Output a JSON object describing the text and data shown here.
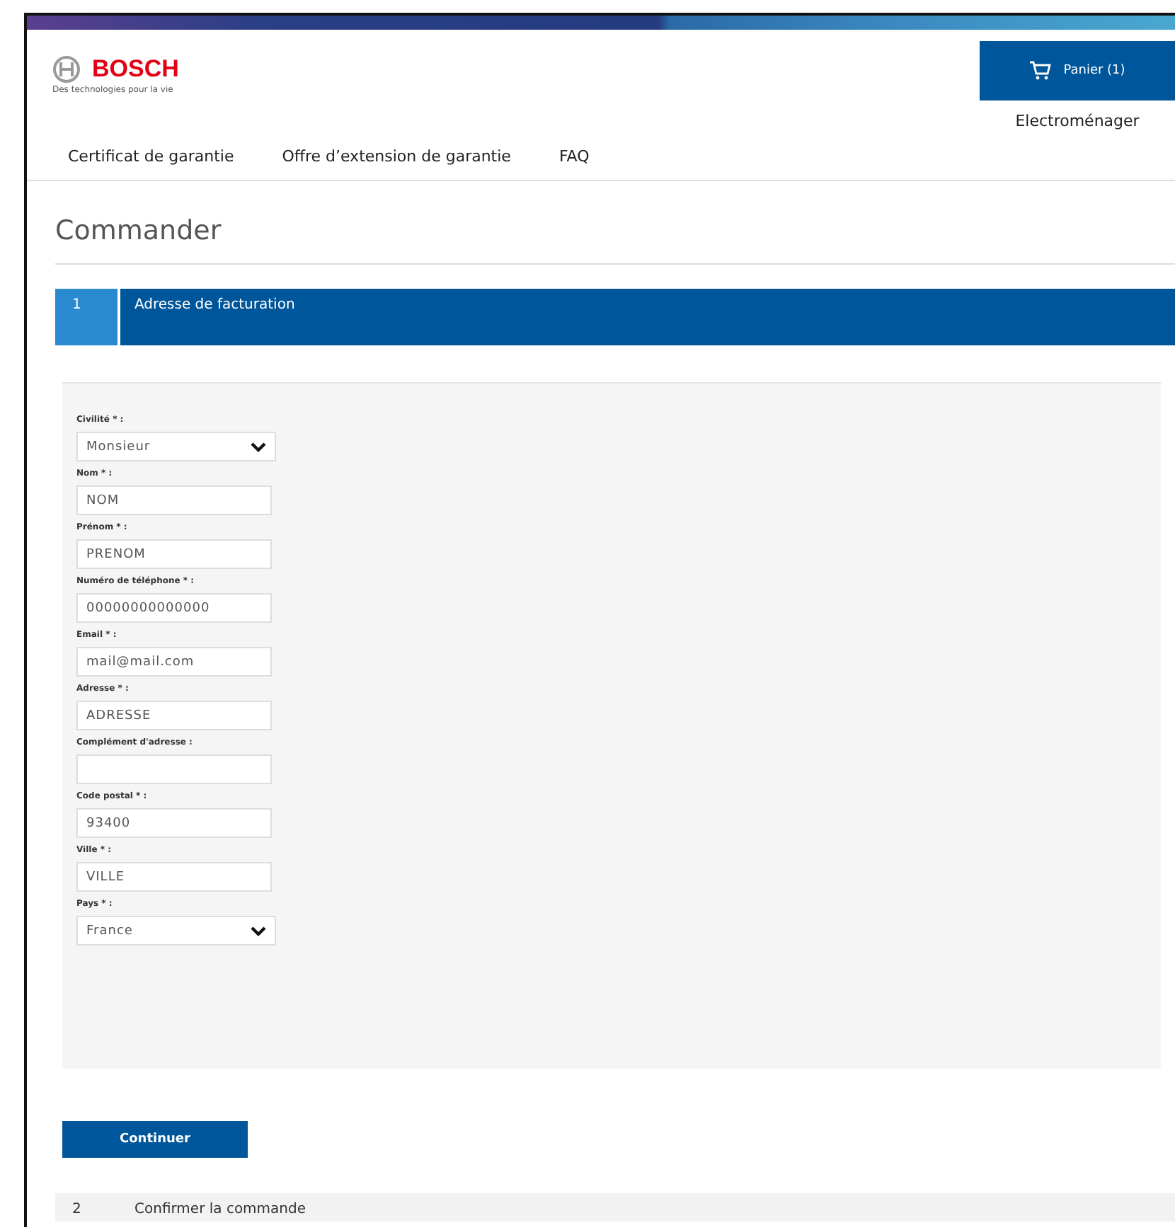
{
  "brand": {
    "name": "BOSCH",
    "tagline": "Des technologies pour la vie"
  },
  "cart": {
    "label": "Panier (1)"
  },
  "category": "Electroménager",
  "nav": [
    {
      "label": "Certificat de garantie"
    },
    {
      "label": "Offre d’extension de garantie"
    },
    {
      "label": "FAQ"
    }
  ],
  "page_title": "Commander",
  "steps": [
    {
      "number": "1",
      "label": "Adresse de facturation",
      "selected": true
    },
    {
      "number": "2",
      "label": "Confirmer la commande",
      "selected": false
    }
  ],
  "fields": [
    {
      "kind": "select",
      "label": "Civilité * :",
      "value": "Monsieur"
    },
    {
      "kind": "input",
      "label": "Nom * :",
      "value": "NOM"
    },
    {
      "kind": "input",
      "label": "Prénom * :",
      "value": "PRENOM"
    },
    {
      "kind": "input",
      "label": "Numéro de téléphone * :",
      "value": "00000000000000"
    },
    {
      "kind": "input",
      "label": "Email * :",
      "value": "mail@mail.com"
    },
    {
      "kind": "input",
      "label": "Adresse * :",
      "value": "ADRESSE"
    },
    {
      "kind": "input",
      "label": "Complément d'adresse :"
    },
    {
      "kind": "input",
      "label": "Code postal * :",
      "value": "93400"
    },
    {
      "kind": "input",
      "label": "Ville * :",
      "value": "VILLE"
    },
    {
      "kind": "select",
      "label": "Pays * :",
      "value": "France"
    }
  ],
  "continue_button": "Continuer"
}
